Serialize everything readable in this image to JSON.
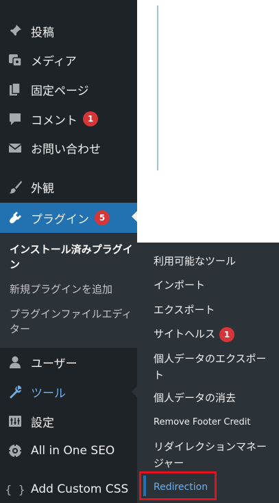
{
  "sidebar": {
    "items": [
      {
        "id": "posts",
        "label": "投稿",
        "icon": "pin-icon"
      },
      {
        "id": "media",
        "label": "メディア",
        "icon": "media-icon"
      },
      {
        "id": "pages",
        "label": "固定ページ",
        "icon": "pages-icon"
      },
      {
        "id": "comments",
        "label": "コメント",
        "icon": "comment-icon",
        "badge": "1"
      },
      {
        "id": "contact",
        "label": "お問い合わせ",
        "icon": "mail-icon"
      },
      {
        "id": "appearance",
        "label": "外観",
        "icon": "brush-icon"
      },
      {
        "id": "plugins",
        "label": "プラグイン",
        "icon": "plugin-icon",
        "badge": "5"
      },
      {
        "id": "users",
        "label": "ユーザー",
        "icon": "user-icon"
      },
      {
        "id": "tools",
        "label": "ツール",
        "icon": "wrench-icon"
      },
      {
        "id": "settings",
        "label": "設定",
        "icon": "settings-icon"
      },
      {
        "id": "aioseo",
        "label": "All in One SEO",
        "icon": "aioseo-icon"
      },
      {
        "id": "customcss",
        "label": "Add Custom CSS",
        "icon": "braces-icon"
      }
    ]
  },
  "plugin_submenu": {
    "items": [
      "インストール済みプラグイン",
      "新規プラグインを追加",
      "プラグインファイルエディター"
    ]
  },
  "tools_flyout": {
    "items": [
      "利用可能なツール",
      "インポート",
      "エクスポート",
      "サイトヘルス",
      "個人データのエクスポート",
      "個人データの消去",
      "Remove Footer Credit",
      "リダイレクションマネージャー",
      "Redirection"
    ],
    "site_health_badge": "1"
  },
  "colors": {
    "sidebar_bg": "#1d2327",
    "submenu_bg": "#2c3338",
    "active_bg": "#2271b1",
    "highlight_text": "#72aee6",
    "badge_bg": "#d63638",
    "annotation_red": "#e1131e"
  }
}
